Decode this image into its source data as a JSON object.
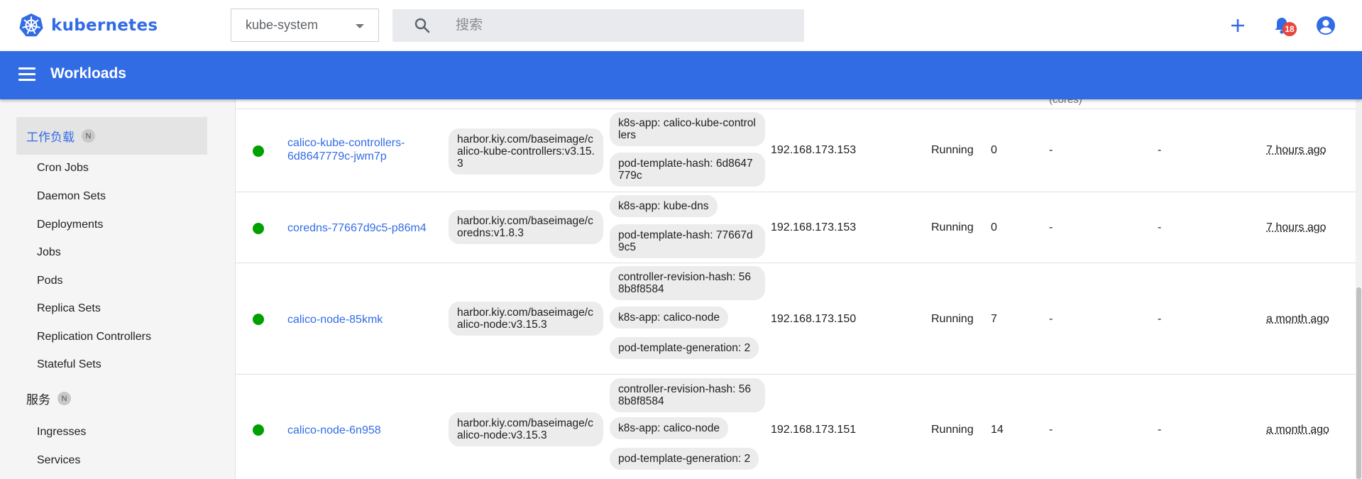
{
  "app": {
    "logo_text": "kubernetes",
    "namespace": "kube-system",
    "search_placeholder": "搜索",
    "notification_count": "18",
    "page_title": "Workloads",
    "colors": {
      "brand": "#326ce5",
      "header": "#326ce5",
      "status_running": "#00a000",
      "badge": "#e8453c"
    }
  },
  "icons": {
    "logo": "kubernetes-wheel-icon",
    "search": "search-icon",
    "add": "plus-icon",
    "notifications": "bell-icon",
    "account": "account-circle-icon",
    "menu": "hamburger-icon",
    "dropdown": "caret-down-icon"
  },
  "sidebar": {
    "sections": [
      {
        "label": "工作负载",
        "badge": "N",
        "active": true,
        "items": [
          "Cron Jobs",
          "Daemon Sets",
          "Deployments",
          "Jobs",
          "Pods",
          "Replica Sets",
          "Replication Controllers",
          "Stateful Sets"
        ]
      },
      {
        "label": "服务",
        "badge": "N",
        "active": false,
        "items": [
          "Ingresses",
          "Services"
        ]
      }
    ]
  },
  "table": {
    "header_fragment": "(cores)",
    "rows": [
      {
        "status": "running",
        "name": "calico-kube-controllers-6d8647779c-jwm7p",
        "image": "harbor.kiy.com/baseimage/calico-kube-controllers:v3.15.3",
        "labels": [
          "k8s-app: calico-kube-controllers",
          "pod-template-hash: 6d8647779c"
        ],
        "node": "192.168.173.153",
        "status_text": "Running",
        "restarts": "0",
        "cpu": "-",
        "memory": "-",
        "age": "7 hours ago"
      },
      {
        "status": "running",
        "name": "coredns-77667d9c5-p86m4",
        "image": "harbor.kiy.com/baseimage/coredns:v1.8.3",
        "labels": [
          "k8s-app: kube-dns",
          "pod-template-hash: 77667d9c5"
        ],
        "node": "192.168.173.153",
        "status_text": "Running",
        "restarts": "0",
        "cpu": "-",
        "memory": "-",
        "age": "7 hours ago"
      },
      {
        "status": "running",
        "name": "calico-node-85kmk",
        "image": "harbor.kiy.com/baseimage/calico-node:v3.15.3",
        "labels": [
          "controller-revision-hash: 568b8f8584",
          "k8s-app: calico-node",
          "pod-template-generation: 2"
        ],
        "node": "192.168.173.150",
        "status_text": "Running",
        "restarts": "7",
        "cpu": "-",
        "memory": "-",
        "age": "a month ago"
      },
      {
        "status": "running",
        "name": "calico-node-6n958",
        "image": "harbor.kiy.com/baseimage/calico-node:v3.15.3",
        "labels": [
          "controller-revision-hash: 568b8f8584",
          "k8s-app: calico-node",
          "pod-template-generation: 2"
        ],
        "node": "192.168.173.151",
        "status_text": "Running",
        "restarts": "14",
        "cpu": "-",
        "memory": "-",
        "age": "a month ago"
      }
    ]
  }
}
